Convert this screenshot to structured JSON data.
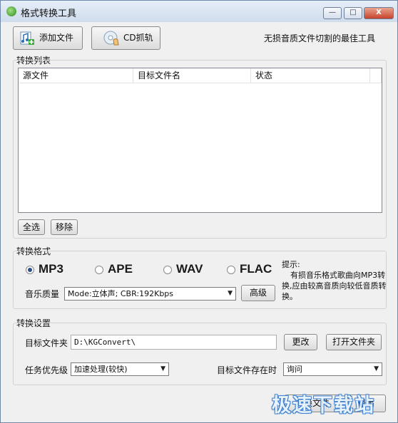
{
  "window": {
    "title": "格式转换工具",
    "minimize": "—",
    "maximize": "□",
    "close": "X"
  },
  "toolbar": {
    "add_file_label": "添加文件",
    "cd_rip_label": "CD抓轨",
    "slogan": "无损音质文件切割的最佳工具"
  },
  "convert_list": {
    "group_label": "转换列表",
    "columns": [
      "源文件",
      "目标文件名",
      "状态"
    ],
    "select_all_label": "全选",
    "remove_label": "移除"
  },
  "format": {
    "group_label": "转换格式",
    "options": [
      {
        "label": "MP3",
        "selected": true
      },
      {
        "label": "APE",
        "selected": false
      },
      {
        "label": "WAV",
        "selected": false
      },
      {
        "label": "FLAC",
        "selected": false
      }
    ],
    "quality_label": "音乐质量",
    "quality_value": "Mode:立体声; CBR:192Kbps",
    "advanced_label": "高级",
    "hint_title": "提示:",
    "hint_text": "有损音乐格式歌曲向MP3转换,应由较高音质向较低音质转换。"
  },
  "settings": {
    "group_label": "转换设置",
    "target_folder_label": "目标文件夹",
    "target_folder_value": "D:\\KGConvert\\",
    "change_label": "更改",
    "open_folder_label": "打开文件夹",
    "priority_label": "任务优先级",
    "priority_value": "加速处理(较快)",
    "exists_label": "目标文件存在时",
    "exists_value": "询问"
  },
  "footer": {
    "convert_label": "转换文件",
    "exit_label": "退出"
  },
  "watermark": "极速下载站"
}
